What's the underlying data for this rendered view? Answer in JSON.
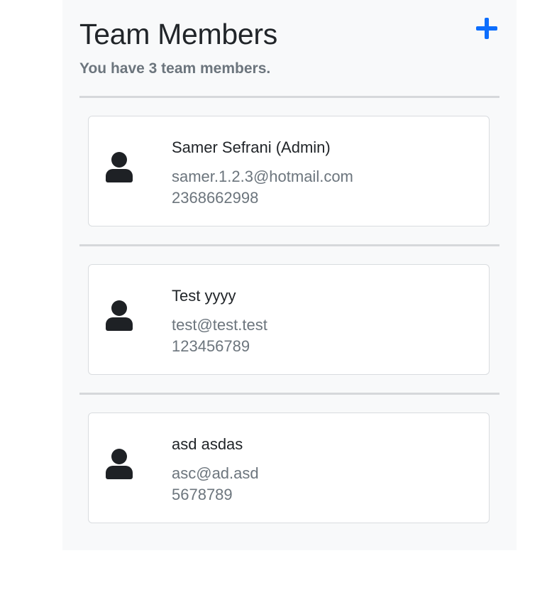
{
  "header": {
    "title": "Team Members",
    "subtitle": "You have 3 team members.",
    "add_icon": "plus-icon"
  },
  "colors": {
    "accent": "#0d6efd",
    "panel_bg": "#f8f9fa",
    "muted_text": "#6c757d",
    "icon": "#1e2125"
  },
  "members": [
    {
      "name": "Samer Sefrani (Admin)",
      "email": "samer.1.2.3@hotmail.com",
      "phone": "2368662998",
      "icon": "person-icon"
    },
    {
      "name": "Test yyyy",
      "email": "test@test.test",
      "phone": "123456789",
      "icon": "person-icon"
    },
    {
      "name": "asd asdas",
      "email": "asc@ad.asd",
      "phone": "5678789",
      "icon": "person-icon"
    }
  ]
}
